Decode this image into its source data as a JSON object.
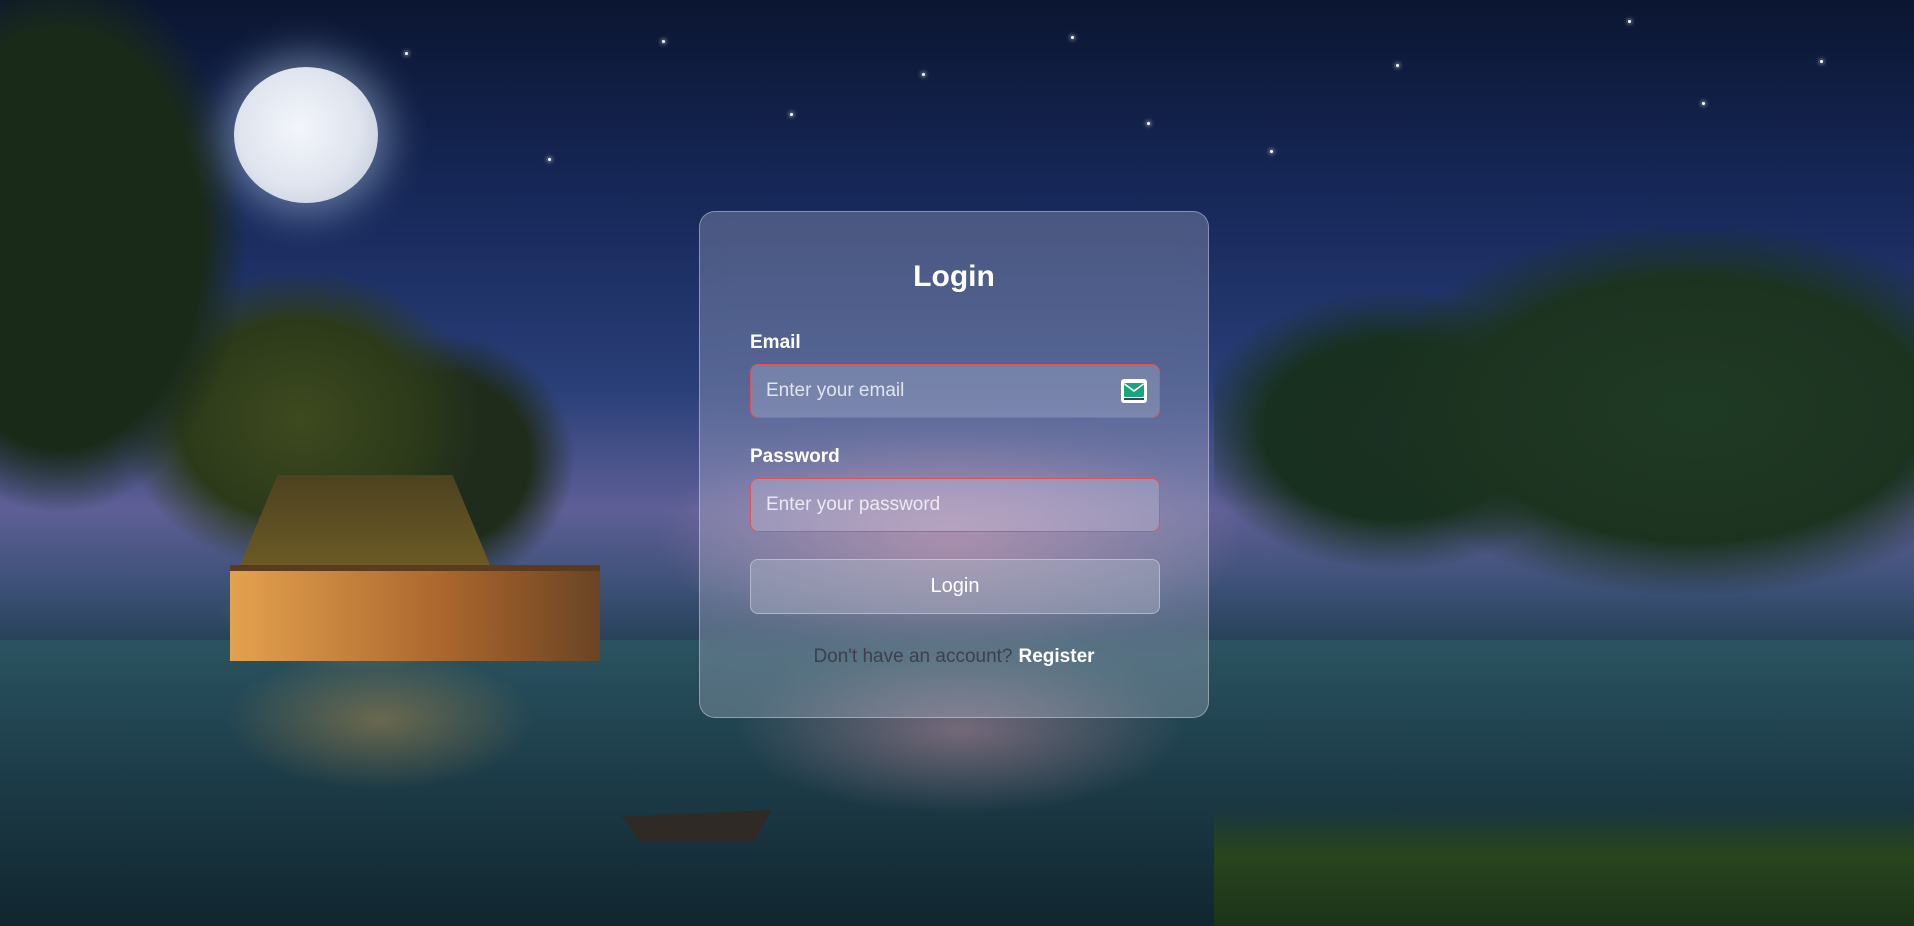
{
  "login_form": {
    "title": "Login",
    "email": {
      "label": "Email",
      "placeholder": "Enter your email",
      "icon": "envelope-icon"
    },
    "password": {
      "label": "Password",
      "placeholder": "Enter your password"
    },
    "submit_label": "Login",
    "register_prompt": "Don't have an account?",
    "register_link": "Register"
  },
  "theme": {
    "input_border_color": "#e0525a",
    "text_color": "#ffffff",
    "icon_accent": "#1aa57f"
  }
}
